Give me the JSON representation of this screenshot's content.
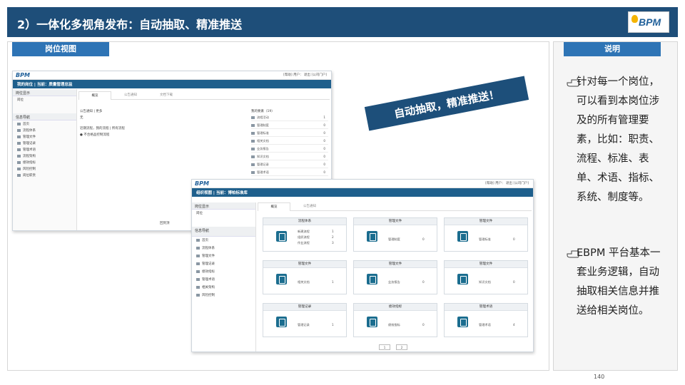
{
  "header": {
    "title": "2）一体化多视角发布：自动抽取、精准推送",
    "logo_text": "BPM"
  },
  "left_section": {
    "label": "岗位视图"
  },
  "right_section": {
    "label": "说明"
  },
  "banner": {
    "text": "自动抽取，精准推送！"
  },
  "descriptions": [
    {
      "text": "针对每一个岗位，可以看到本岗位涉及的所有管理要素，比如：职责、流程、标准、表单、术语、指标、系统、制度等。"
    },
    {
      "text": "EBPM 平台基本一套业务逻辑，自动抽取相关信息并推送给相关岗位。"
    }
  ],
  "page_number": "140",
  "screenshot_back": {
    "logo": "BPM",
    "top_links": "[帮助]  用户：   退出  [公司门户]",
    "nav_title": "我的岗位  |  当前：质量管理总监",
    "sidebar_head": "岗位显示",
    "sidebar_sub": "岗位",
    "sidebar_group": "信息导航",
    "sidebar_items": [
      "首页",
      "流程体系",
      "管理文件",
      "管理记录",
      "管理术语",
      "流程架构",
      "绩效指标",
      "风险控制",
      "岗位职责"
    ],
    "tabs": [
      "概览",
      "公告通知",
      "文档下载"
    ],
    "content_lines": [
      "公告通知 | 更多",
      "无",
      "近期流程，我的流程 | 所有流程",
      "● 不合格品控制流程"
    ],
    "list_head": "我的要素（19）",
    "list_items": [
      {
        "label": "流程活动",
        "value": "1"
      },
      {
        "label": "管理制度",
        "value": "0"
      },
      {
        "label": "管理标准",
        "value": "0"
      },
      {
        "label": "相关文档",
        "value": "0"
      },
      {
        "label": "业务报告",
        "value": "0"
      },
      {
        "label": "知识文档",
        "value": "0"
      },
      {
        "label": "管理记录",
        "value": "0"
      },
      {
        "label": "管理术语",
        "value": "0"
      }
    ],
    "footer": "回到顶"
  },
  "screenshot_front": {
    "logo": "BPM",
    "top_links": "[帮助]  用户：   退出  [公司门户]",
    "nav_title": "组织视图  |  当前：博柏标准库",
    "sidebar_head": "岗位显示",
    "sidebar_sub": "岗位",
    "sidebar_group": "信息导航",
    "sidebar_items": [
      "首页",
      "流程体系",
      "管理文件",
      "管理记录",
      "绩效指标",
      "管理术语",
      "相关架构",
      "风险控制"
    ],
    "tabs": [
      "概览",
      "公告通知"
    ],
    "cards": [
      {
        "title": "流程体系",
        "rows": [
          {
            "label": "新建流程",
            "value": "1"
          },
          {
            "label": "组织流程",
            "value": "2"
          },
          {
            "label": "作业流程",
            "value": "3"
          }
        ]
      },
      {
        "title": "管理文件",
        "rows": [
          {
            "label": "管理制度",
            "value": "0"
          }
        ]
      },
      {
        "title": "管理文件",
        "rows": [
          {
            "label": "管理标准",
            "value": "0"
          }
        ]
      },
      {
        "title": "管理文件",
        "rows": [
          {
            "label": "相关文档",
            "value": "1"
          }
        ]
      },
      {
        "title": "管理文件",
        "rows": [
          {
            "label": "业务报告",
            "value": "0"
          }
        ]
      },
      {
        "title": "管理文件",
        "rows": [
          {
            "label": "知识文档",
            "value": "0"
          }
        ]
      },
      {
        "title": "管理记录",
        "rows": [
          {
            "label": "管理记录",
            "value": "1"
          }
        ]
      },
      {
        "title": "绩效指标",
        "rows": [
          {
            "label": "绩效指标",
            "value": "0"
          }
        ]
      },
      {
        "title": "管理术语",
        "rows": [
          {
            "label": "管理术语",
            "value": "4"
          }
        ]
      }
    ],
    "pager": [
      "1",
      "2"
    ]
  }
}
